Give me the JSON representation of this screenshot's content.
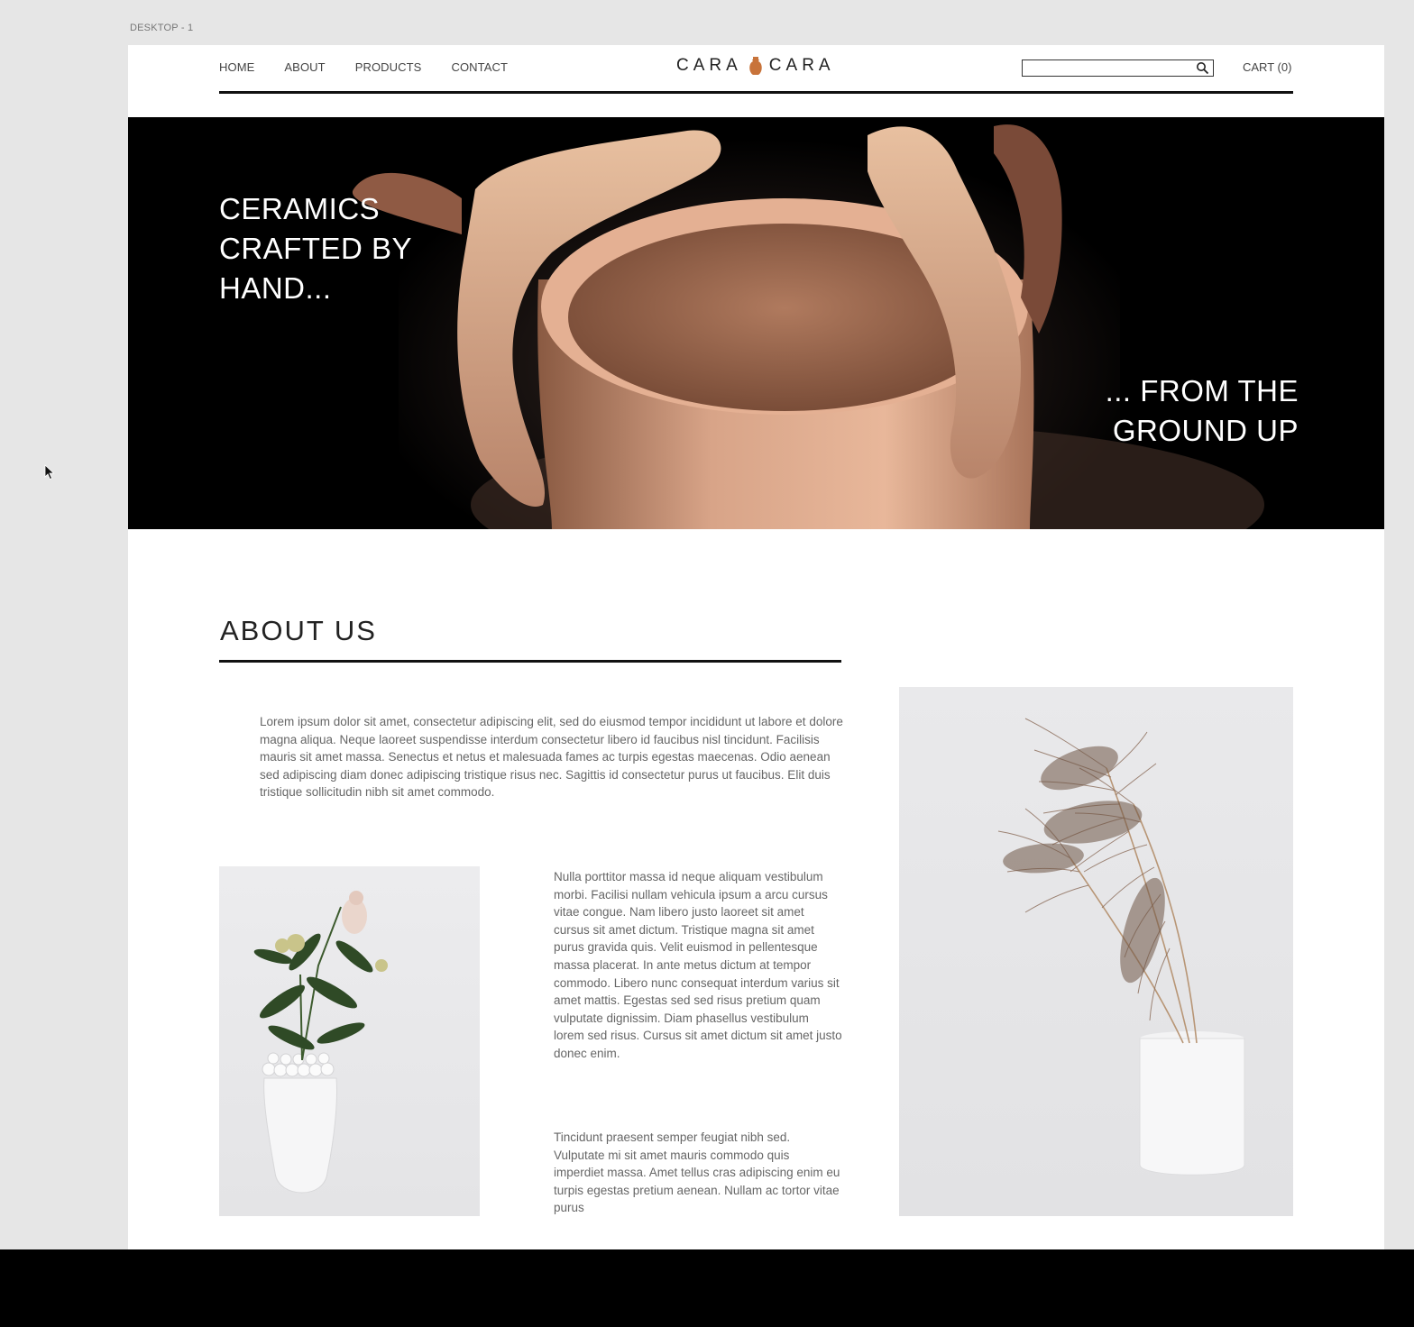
{
  "artboard": {
    "label": "DESKTOP - 1"
  },
  "header": {
    "nav": [
      "HOME",
      "ABOUT",
      "PRODUCTS",
      "CONTACT"
    ],
    "logo_left": "CARA",
    "logo_right": "CARA",
    "search_value": "",
    "cart_label": "CART (0)"
  },
  "hero": {
    "left_lines": [
      "CERAMICS",
      "CRAFTED BY",
      "HAND..."
    ],
    "right_lines": [
      "... FROM THE",
      "GROUND UP"
    ]
  },
  "about": {
    "title": "ABOUT US",
    "para1": "Lorem ipsum dolor sit amet, consectetur adipiscing elit, sed do eiusmod tempor incididunt ut labore et dolore magna aliqua. Neque laoreet suspendisse interdum consectetur libero id faucibus nisl tincidunt. Facilisis mauris sit amet massa. Senectus et netus et malesuada fames ac turpis egestas maecenas. Odio aenean sed adipiscing diam donec adipiscing tristique risus nec. Sagittis id consectetur purus ut faucibus. Elit duis tristique sollicitudin nibh sit amet commodo.",
    "para2": "Nulla porttitor massa id neque aliquam vestibulum morbi. Facilisi nullam vehicula ipsum a arcu cursus vitae congue. Nam libero justo laoreet sit amet cursus sit amet dictum. Tristique magna sit amet purus gravida quis. Velit euismod in pellentesque massa placerat. In ante metus dictum at tempor commodo. Libero nunc consequat interdum varius sit amet mattis. Egestas sed sed risus pretium quam vulputate dignissim. Diam phasellus vestibulum lorem sed risus. Cursus sit amet dictum sit amet justo donec enim.",
    "para3": "Tincidunt praesent semper feugiat nibh sed. Vulputate mi sit amet mauris commodo quis imperdiet massa. Amet tellus cras adipiscing enim eu turpis egestas pretium aenean. Nullam ac tortor vitae purus"
  },
  "icons": {
    "search": "search-icon",
    "logo_mark": "pot-icon",
    "cursor": "cursor-icon"
  },
  "colors": {
    "accent": "#c8733a",
    "rule": "#111111",
    "text": "#666666"
  }
}
